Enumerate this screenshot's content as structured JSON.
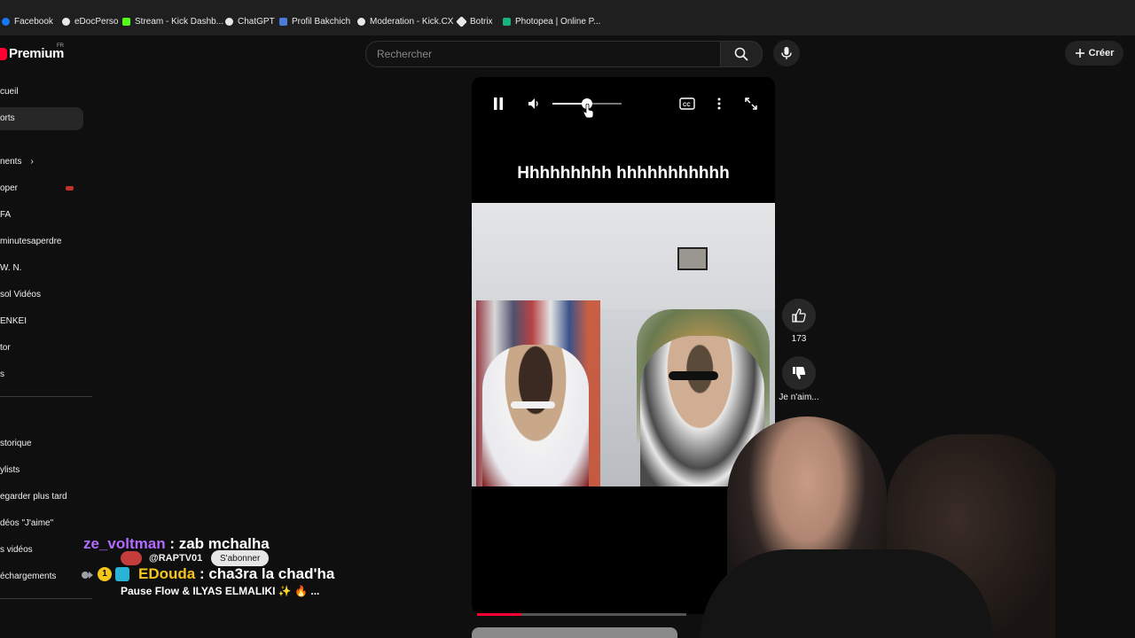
{
  "bookmarks": [
    {
      "label": "Facebook",
      "color": "#1877f2"
    },
    {
      "label": "eDocPerso",
      "color": "#e8e8e8"
    },
    {
      "label": "Stream - Kick Dashb...",
      "color": "#53fc18"
    },
    {
      "label": "ChatGPT",
      "color": "#e8e8e8"
    },
    {
      "label": "Profil Bakchich",
      "color": "#4a7bd8"
    },
    {
      "label": "Moderation - Kick.CX",
      "color": "#e8e8e8"
    },
    {
      "label": "Botrix",
      "color": "#e8e8e8"
    },
    {
      "label": "Photopea | Online P...",
      "color": "#19b37d"
    }
  ],
  "header": {
    "logo_text": "Premium",
    "logo_region": "FR",
    "search_placeholder": "Rechercher",
    "create_label": "Créer"
  },
  "sidebar": {
    "items": [
      {
        "label": "cueil"
      },
      {
        "label": "orts",
        "active": true
      },
      {
        "label": "nents"
      },
      {
        "label": "oper"
      },
      {
        "label": "FA"
      },
      {
        "label": "minutesaperdre"
      },
      {
        "label": "W. N."
      },
      {
        "label": "sol Vidéos"
      },
      {
        "label": "ENKEI"
      },
      {
        "label": "tor"
      },
      {
        "label": "s"
      },
      {
        "label": "storique"
      },
      {
        "label": "ylists"
      },
      {
        "label": "egarder plus tard"
      },
      {
        "label": "déos \"J'aime\""
      },
      {
        "label": "s vidéos"
      },
      {
        "label": "échargements"
      }
    ]
  },
  "player": {
    "caption": "Hhhhhhhhh hhhhhhhhhhh",
    "volume_level": 0.5,
    "progress_fraction": 0.21
  },
  "actions": {
    "like_count": "173",
    "dislike_label": "Je n'aim..."
  },
  "chat": {
    "line1_user": "ze_voltman",
    "line1_msg": " : zab mchalha",
    "line1_user_color": "#b36bff",
    "line2_handle": "@RAPTV01",
    "subscribe_label": "S'abonner",
    "line2_user": "EDouda",
    "line2_msg": " : cha3ra la chad'ha",
    "line2_user_color": "#f5c518",
    "line3": "Pause Flow & ILYAS ELMALIKI ✨ 🔥 ..."
  },
  "colors": {
    "accent": "#ff0033",
    "background": "#0f0f0f"
  }
}
